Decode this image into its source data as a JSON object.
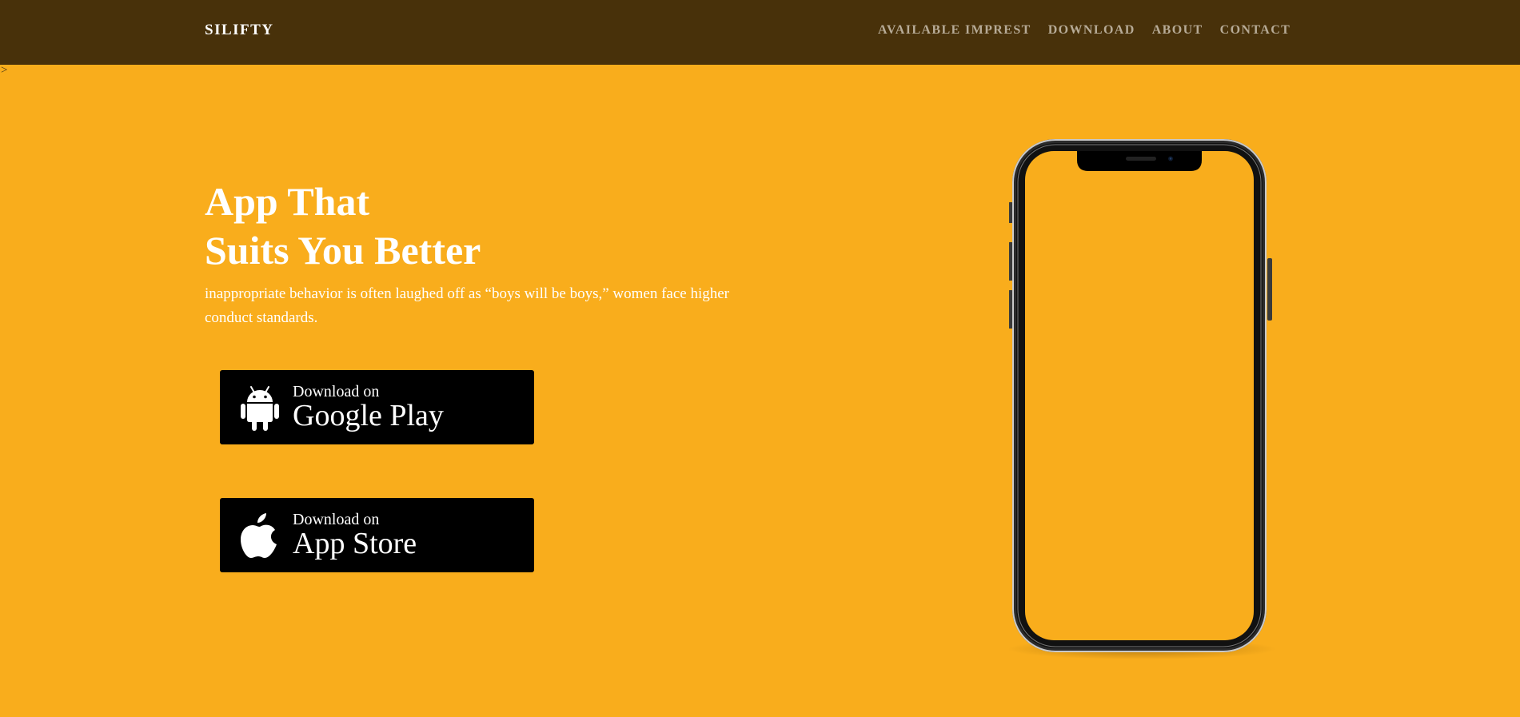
{
  "nav": {
    "brand": "SILIFTY",
    "links": [
      "AVAILABLE IMPREST",
      "DOWNLOAD",
      "ABOUT",
      "CONTACT"
    ]
  },
  "stray_text": ">",
  "hero": {
    "title_line1": "App That",
    "title_line2": "Suits You Better",
    "description": "inappropriate behavior is often laughed off as “boys will be boys,” women face higher conduct standards."
  },
  "buttons": {
    "google": {
      "small": "Download on",
      "big": "Google Play",
      "icon": "android-icon"
    },
    "apple": {
      "small": "Download on",
      "big": "App Store",
      "icon": "apple-icon"
    }
  },
  "colors": {
    "background": "#f9ad1c",
    "navbar": "#48310a",
    "nav_link": "#b7ab97",
    "button": "#000000"
  }
}
